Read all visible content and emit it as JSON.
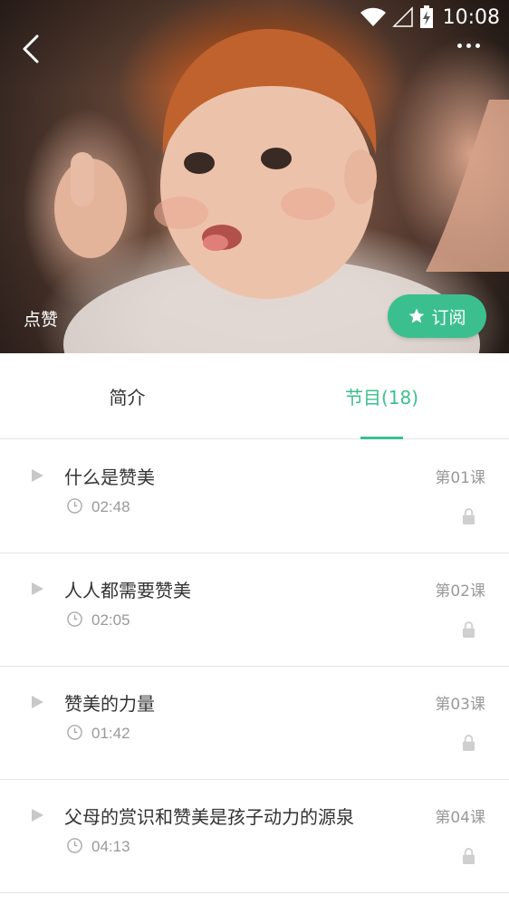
{
  "status_bar": {
    "time": "10:08",
    "icons": [
      "wifi-icon",
      "signal-icon",
      "battery-charging-icon"
    ]
  },
  "header": {
    "back_icon": "chevron-left-icon",
    "more_icon": "more-horizontal-icon",
    "like_label": "点赞",
    "subscribe": {
      "label": "订阅",
      "icon": "star-icon",
      "color": "#3cbf8f"
    }
  },
  "tabs": [
    {
      "label": "简介",
      "active": false
    },
    {
      "label": "节目(18)",
      "active": true
    }
  ],
  "accent_color": "#3cbf8f",
  "lessons": [
    {
      "title": "什么是赞美",
      "duration": "02:48",
      "number": "第01课",
      "locked": true
    },
    {
      "title": "人人都需要赞美",
      "duration": "02:05",
      "number": "第02课",
      "locked": true
    },
    {
      "title": "赞美的力量",
      "duration": "01:42",
      "number": "第03课",
      "locked": true
    },
    {
      "title": "父母的赏识和赞美是孩子动力的源泉",
      "duration": "04:13",
      "number": "第04课",
      "locked": true
    }
  ]
}
